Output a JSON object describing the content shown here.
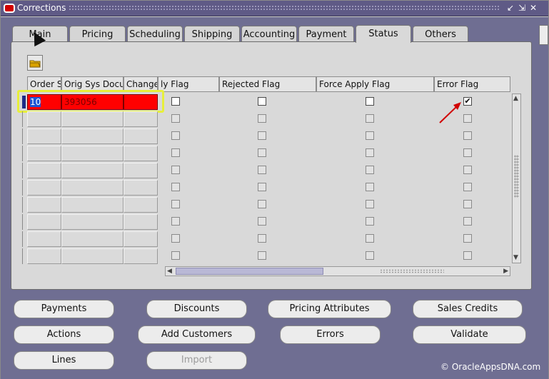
{
  "window": {
    "title": "Corrections",
    "controls": [
      "↙",
      "⇲",
      "✕"
    ]
  },
  "tabs": [
    {
      "label": "Main"
    },
    {
      "label": "Pricing"
    },
    {
      "label": "Scheduling"
    },
    {
      "label": "Shipping"
    },
    {
      "label": "Accounting"
    },
    {
      "label": "Payment"
    },
    {
      "label": "Status",
      "active": true
    },
    {
      "label": "Others"
    }
  ],
  "grid": {
    "columns": [
      "Order S",
      "Orig Sys Docu",
      "Change",
      "ly Flag",
      "Rejected Flag",
      "Force Apply Flag",
      "Error Flag"
    ],
    "first_row": {
      "order_s": "10",
      "orig_sys_docu": "393056",
      "change": "",
      "apply_flag": false,
      "rejected_flag": false,
      "force_apply_flag": false,
      "error_flag": true
    }
  },
  "buttons": {
    "payments": "Payments",
    "discounts": "Discounts",
    "pricing_attributes": "Pricing Attributes",
    "sales_credits": "Sales Credits",
    "actions": "Actions",
    "add_customers": "Add Customers",
    "errors": "Errors",
    "validate": "Validate",
    "lines": "Lines",
    "import": "Import"
  },
  "copyright": "© OracleAppsDNA.com",
  "colors": {
    "window_bg": "#6f6e92",
    "highlight_yellow": "#e7ef3b",
    "error_red": "#ff0000",
    "arrow_red": "#d10000"
  }
}
